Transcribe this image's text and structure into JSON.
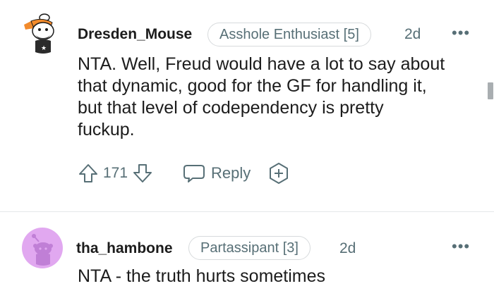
{
  "comments": [
    {
      "username": "Dresden_Mouse",
      "flair": "Asshole Enthusiast [5]",
      "time": "2d",
      "more": "•••",
      "body_lines": [
        "NTA. Well, Freud would have a lot to say about",
        "that dynamic, good for the GF for handling it,",
        "but that level of codependency is pretty",
        "fuckup."
      ],
      "vote_count": "171",
      "reply_label": "Reply",
      "avatar_icon": "snoo-avatar-icon"
    },
    {
      "username": "tha_hambone",
      "flair": "Partassipant [3]",
      "time": "2d",
      "more": "•••",
      "body_lines": [
        "NTA - the truth hurts sometimes"
      ],
      "avatar_icon": "snoo-avatar-icon",
      "avatar_color": "#e1a8f0"
    }
  ],
  "colors": {
    "meta_gray": "#576f76",
    "text": "#1c1c1c",
    "border": "#d7dadc"
  }
}
